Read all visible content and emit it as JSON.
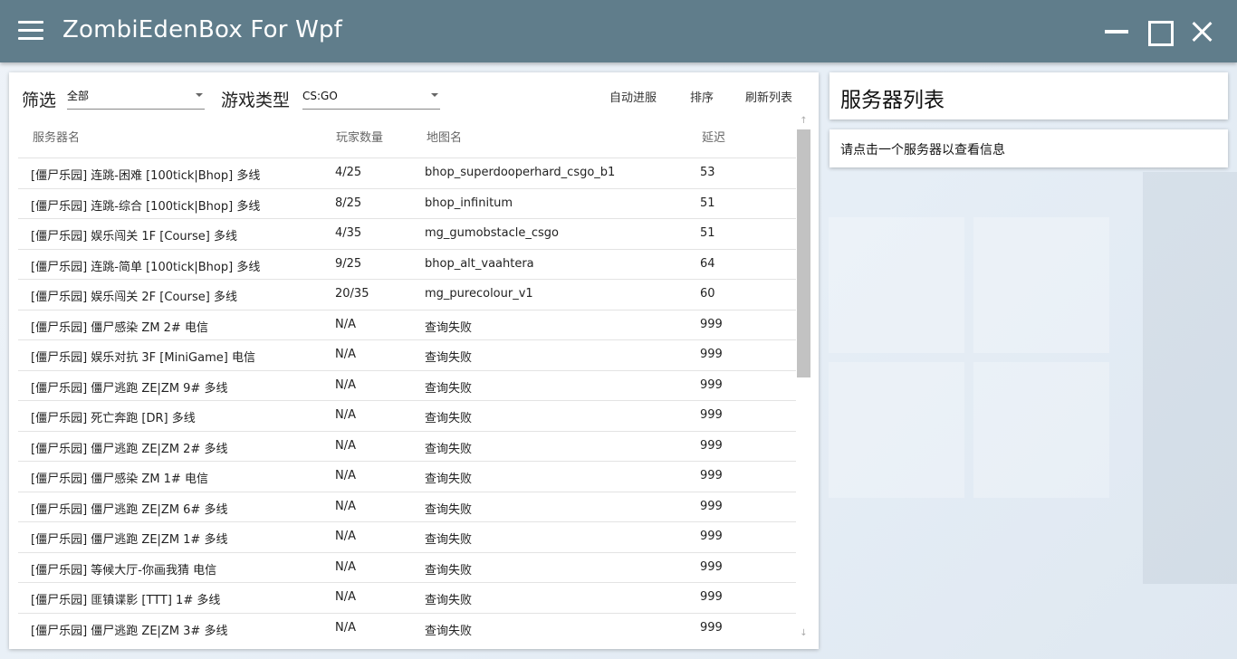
{
  "app": {
    "title": "ZombiEdenBox For Wpf"
  },
  "filters": {
    "filter_label": "筛选",
    "filter_value": "全部",
    "game_type_label": "游戏类型",
    "game_type_value": "CS:GO"
  },
  "toolbar": {
    "auto_join": "自动进服",
    "sort": "排序",
    "refresh": "刷新列表"
  },
  "table": {
    "headers": [
      "服务器名",
      "玩家数量",
      "地图名",
      "延迟"
    ],
    "rows": [
      {
        "name": "[僵尸乐园] 连跳-困难 [100tick|Bhop] 多线",
        "players": "4/25",
        "map": "bhop_superdooperhard_csgo_b1",
        "ping": "53"
      },
      {
        "name": "[僵尸乐园] 连跳-综合 [100tick|Bhop] 多线",
        "players": "8/25",
        "map": "bhop_infinitum",
        "ping": "51"
      },
      {
        "name": "[僵尸乐园] 娱乐闯关 1F [Course] 多线",
        "players": "4/35",
        "map": "mg_gumobstacle_csgo",
        "ping": "51"
      },
      {
        "name": "[僵尸乐园] 连跳-简单 [100tick|Bhop] 多线",
        "players": "9/25",
        "map": "bhop_alt_vaahtera",
        "ping": "64"
      },
      {
        "name": "[僵尸乐园] 娱乐闯关 2F [Course] 多线",
        "players": "20/35",
        "map": "mg_purecolour_v1",
        "ping": "60"
      },
      {
        "name": "[僵尸乐园] 僵尸感染 ZM 2# 电信",
        "players": "N/A",
        "map": "查询失败",
        "ping": "999"
      },
      {
        "name": "[僵尸乐园] 娱乐对抗 3F [MiniGame] 电信",
        "players": "N/A",
        "map": "查询失败",
        "ping": "999"
      },
      {
        "name": "[僵尸乐园] 僵尸逃跑 ZE|ZM 9# 多线",
        "players": "N/A",
        "map": "查询失败",
        "ping": "999"
      },
      {
        "name": "[僵尸乐园] 死亡奔跑 [DR] 多线",
        "players": "N/A",
        "map": "查询失败",
        "ping": "999"
      },
      {
        "name": "[僵尸乐园] 僵尸逃跑 ZE|ZM 2# 多线",
        "players": "N/A",
        "map": "查询失败",
        "ping": "999"
      },
      {
        "name": "[僵尸乐园] 僵尸感染 ZM 1# 电信",
        "players": "N/A",
        "map": "查询失败",
        "ping": "999"
      },
      {
        "name": "[僵尸乐园] 僵尸逃跑 ZE|ZM 6# 多线",
        "players": "N/A",
        "map": "查询失败",
        "ping": "999"
      },
      {
        "name": "[僵尸乐园] 僵尸逃跑 ZE|ZM 1# 多线",
        "players": "N/A",
        "map": "查询失败",
        "ping": "999"
      },
      {
        "name": "[僵尸乐园] 等候大厅-你画我猜 电信",
        "players": "N/A",
        "map": "查询失败",
        "ping": "999"
      },
      {
        "name": "[僵尸乐园] 匪镇谍影 [TTT] 1# 多线",
        "players": "N/A",
        "map": "查询失败",
        "ping": "999"
      },
      {
        "name": "[僵尸乐园] 僵尸逃跑 ZE|ZM 3# 多线",
        "players": "N/A",
        "map": "查询失败",
        "ping": "999"
      }
    ]
  },
  "side": {
    "title": "服务器列表",
    "info": "请点击一个服务器以查看信息"
  },
  "colors": {
    "titlebar": "#607d8b",
    "scroll_thumb": "#c2c2c2"
  },
  "icons": {
    "menu": "menu-icon",
    "minimize": "minimize-icon",
    "maximize": "maximize-icon",
    "close": "close-icon"
  }
}
